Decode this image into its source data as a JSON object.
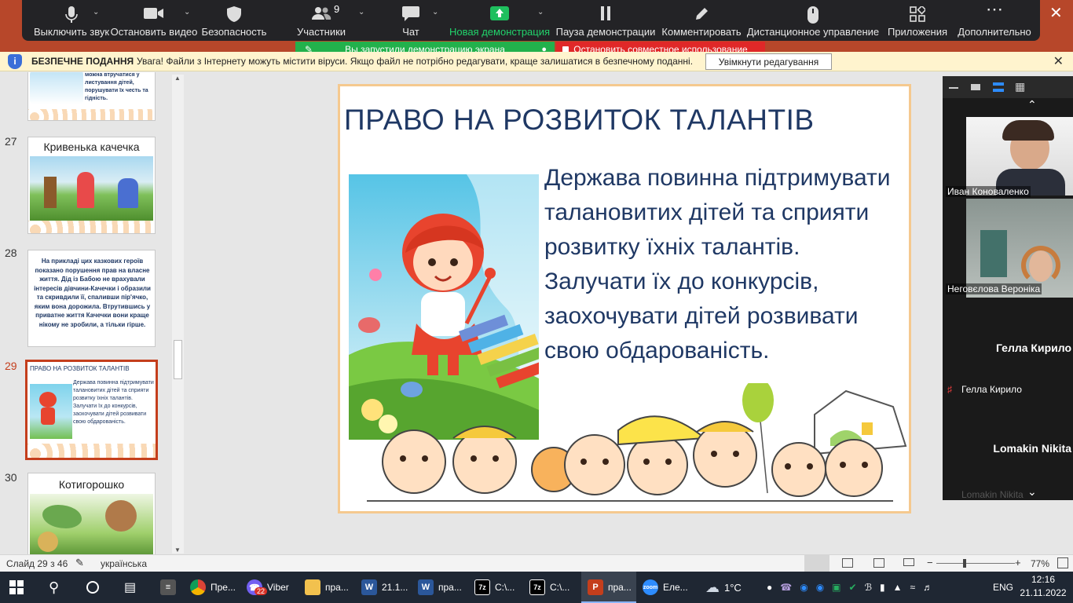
{
  "zoom_toolbar": {
    "buttons": [
      {
        "label": "Выключить звук",
        "icon": "microphone-icon"
      },
      {
        "label": "Остановить видео",
        "icon": "video-camera-icon"
      },
      {
        "label": "Безопасность",
        "icon": "shield-icon"
      },
      {
        "label": "Участники",
        "icon": "participants-icon",
        "badge": "9"
      },
      {
        "label": "Чат",
        "icon": "chat-icon"
      },
      {
        "label": "Новая демонстрация",
        "icon": "share-screen-icon"
      },
      {
        "label": "Пауза демонстрации",
        "icon": "pause-icon"
      },
      {
        "label": "Комментировать",
        "icon": "pen-icon"
      },
      {
        "label": "Дистанционное управление",
        "icon": "mouse-icon"
      },
      {
        "label": "Приложения",
        "icon": "apps-icon"
      },
      {
        "label": "Дополнительно",
        "icon": "more-icon"
      }
    ],
    "share_status": "Вы запустили демонстрацию экрана",
    "stop_share": "Остановить совместное использование"
  },
  "security_bar": {
    "title": "БЕЗПЕЧНЕ ПОДАННЯ",
    "message": "Увага! Файли з Інтернету можуть містити віруси. Якщо файл не потрібно редагувати, краще залишатися в безпечному поданні.",
    "enable_button": "Увімкнути редагування"
  },
  "thumbnails": {
    "items": [
      {
        "number": "",
        "text": "можна втручатися у листування дітей, порушувати їх честь та гідність."
      },
      {
        "number": "27",
        "title": "Кривенька качечка"
      },
      {
        "number": "28",
        "text": "На прикладі цих казкових героїв показано порушення прав на власне життя. Дід із Бабою не врахували інтересів дівчини-Качечки і образили та скривдили її, спаливши пір'ячко, яким вона дорожила. Втрутившись у приватне життя Качечки вони краще нікому не зробили, а тільки гірше."
      },
      {
        "number": "29",
        "title": "ПРАВО НА РОЗВИТОК ТАЛАНТІВ",
        "text": "Держава повинна підтримувати талановитих дітей та сприяти розвитку їхніх талантів. Залучати їх до конкурсів, заохочувати дітей розвивати свою обдарованість."
      },
      {
        "number": "30",
        "title": "Котигорошко"
      }
    ]
  },
  "slide": {
    "title": "ПРАВО НА РОЗВИТОК ТАЛАНТІВ",
    "body": "Держава повинна підтримувати талановитих дітей та сприяти розвитку їхніх талантів. Залучати їх до конкурсів, заохочувати дітей розвивати свою обдарованість."
  },
  "gallery": {
    "participants": [
      {
        "name": "Иван Коноваленко"
      },
      {
        "name": "Неговєлова Вероніка"
      },
      {
        "name": "Гелла Кирило",
        "big": "Гелла Кирило"
      },
      {
        "name": "Lomakin Nikita",
        "big": "Lomakin Nikita"
      }
    ]
  },
  "status_bar": {
    "slide_info": "Слайд 29 з 46",
    "language": "українська",
    "zoom": "77%"
  },
  "taskbar": {
    "apps": [
      {
        "label": "Пре...",
        "icon": "chrome-icon"
      },
      {
        "label": "Viber",
        "icon": "viber-icon",
        "badge": "22"
      },
      {
        "label": "пра...",
        "icon": "folder-icon"
      },
      {
        "label": "21.1...",
        "icon": "word-icon"
      },
      {
        "label": "пра...",
        "icon": "word-icon"
      },
      {
        "label": "C:\\...",
        "icon": "7zip-icon"
      },
      {
        "label": "C:\\...",
        "icon": "7zip-icon"
      },
      {
        "label": "пра...",
        "icon": "powerpoint-icon"
      },
      {
        "label": "Еле...",
        "icon": "zoom-icon"
      }
    ],
    "weather": "1°C",
    "language": "ENG",
    "time": "12:16",
    "date": "21.11.2022"
  }
}
